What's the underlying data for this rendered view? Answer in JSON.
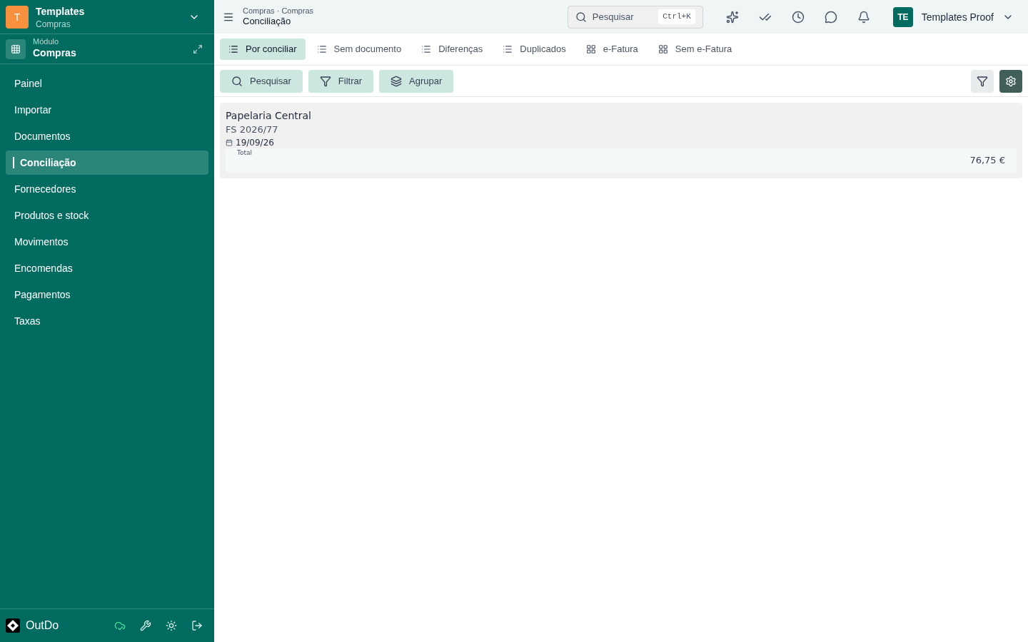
{
  "org": {
    "initial": "T",
    "name": "Templates",
    "subtitle": "Compras"
  },
  "module": {
    "label": "Módulo",
    "name": "Compras"
  },
  "sidebar": {
    "items": [
      {
        "label": "Painel",
        "selected": false
      },
      {
        "label": "Importar",
        "selected": false
      },
      {
        "label": "Documentos",
        "selected": false
      },
      {
        "label": "Conciliação",
        "selected": true
      },
      {
        "label": "Fornecedores",
        "selected": false
      },
      {
        "label": "Produtos e stock",
        "selected": false
      },
      {
        "label": "Movimentos",
        "selected": false
      },
      {
        "label": "Encomendas",
        "selected": false
      },
      {
        "label": "Pagamentos",
        "selected": false
      },
      {
        "label": "Taxas",
        "selected": false
      }
    ]
  },
  "brand": {
    "name": "OutDo"
  },
  "header": {
    "breadcrumb": "Compras · Compras",
    "title": "Conciliação",
    "search": {
      "placeholder": "Pesquisar",
      "shortcut": "Ctrl+K"
    },
    "user": {
      "initials": "TE",
      "name": "Templates Proof"
    }
  },
  "tabs": [
    {
      "label": "Por conciliar",
      "kind": "list",
      "selected": true
    },
    {
      "label": "Sem documento",
      "kind": "list",
      "selected": false
    },
    {
      "label": "Diferenças",
      "kind": "list",
      "selected": false
    },
    {
      "label": "Duplicados",
      "kind": "list",
      "selected": false
    },
    {
      "label": "e-Fatura",
      "kind": "grid",
      "selected": false
    },
    {
      "label": "Sem e-Fatura",
      "kind": "grid",
      "selected": false
    }
  ],
  "toolbar": [
    {
      "label": "Pesquisar",
      "kind": "search"
    },
    {
      "label": "Filtrar",
      "kind": "filter"
    },
    {
      "label": "Agrupar",
      "kind": "group"
    }
  ],
  "records": [
    {
      "supplier": "Papelaria Central",
      "document": "FS 2026/77",
      "date": "19/09/26",
      "total_label": "Total",
      "total": "76,75 €"
    }
  ]
}
